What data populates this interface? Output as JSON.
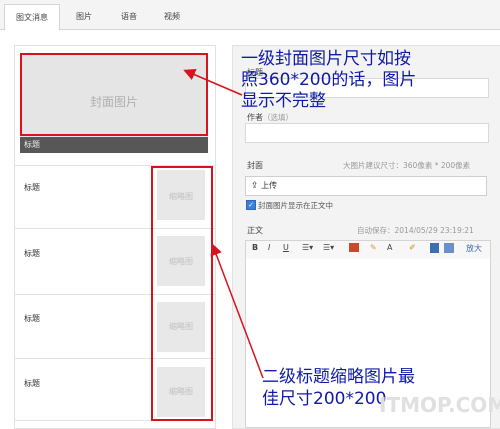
{
  "tabs": [
    {
      "label": "图文消息",
      "active": true
    },
    {
      "label": "图片",
      "active": false
    },
    {
      "label": "语音",
      "active": false
    },
    {
      "label": "视频",
      "active": false
    }
  ],
  "left_list": {
    "cover": {
      "placeholder": "封面图片",
      "title": "标题"
    },
    "items": [
      {
        "title": "标题",
        "thumb": "缩略图"
      },
      {
        "title": "标题",
        "thumb": "缩略图"
      },
      {
        "title": "标题",
        "thumb": "缩略图"
      },
      {
        "title": "标题",
        "thumb": "缩略图"
      }
    ]
  },
  "form": {
    "title_label": "标题",
    "author_label": "作者",
    "author_optional": "（选填）",
    "cover_label": "封面",
    "cover_hint": "大图片建议尺寸：360像素 * 200像素",
    "upload_button": "上传",
    "show_cover_checkbox": "封面图片显示在正文中",
    "body_label": "正文",
    "autosave": "自动保存：2014/05/29 23:19:21",
    "toolbar": {
      "bold": "B",
      "italic": "I",
      "underline": "U",
      "list1": "☰▾",
      "list2": "☰▾",
      "font_color": "A",
      "enlarge": "放大"
    }
  },
  "annotations": {
    "top_line1": "一级封面图片尺寸如按",
    "top_line2": "照360*200的话，图片",
    "top_line3": "显示不完整",
    "bottom_line1": "二级标题缩略图片最",
    "bottom_line2": "佳尺寸200*200"
  },
  "watermark": "ITMOP.COM",
  "colors": {
    "annotation_red": "#d8131d",
    "annotation_blue": "#0f1aa8",
    "checkbox_blue": "#3c7fd4"
  }
}
